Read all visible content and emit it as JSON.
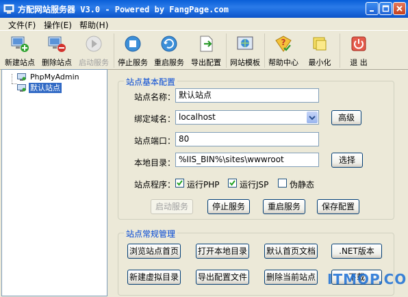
{
  "window": {
    "title": "方配网站服务器 V3.0 - Powered by FangPage.com"
  },
  "menu": [
    {
      "label": "文件(F)"
    },
    {
      "label": "操作(E)"
    },
    {
      "label": "帮助(H)"
    }
  ],
  "toolbar": [
    {
      "label": "新建站点",
      "icon": "new-site-icon",
      "enabled": true
    },
    {
      "label": "删除站点",
      "icon": "delete-site-icon",
      "enabled": true
    },
    {
      "label": "启动服务",
      "icon": "play-icon",
      "enabled": false
    },
    {
      "label": "停止服务",
      "icon": "stop-icon",
      "enabled": true
    },
    {
      "label": "重启服务",
      "icon": "restart-icon",
      "enabled": true
    },
    {
      "label": "导出配置",
      "icon": "export-icon",
      "enabled": true
    },
    {
      "label": "网站模板",
      "icon": "template-icon",
      "enabled": true
    },
    {
      "label": "帮助中心",
      "icon": "help-icon",
      "enabled": true
    },
    {
      "label": "最小化",
      "icon": "minimize-icon",
      "enabled": true
    },
    {
      "label": "退 出",
      "icon": "exit-icon",
      "enabled": true
    }
  ],
  "tree": [
    {
      "label": "PhpMyAdmin",
      "selected": false
    },
    {
      "label": "默认站点",
      "selected": true
    }
  ],
  "basic_config": {
    "title": "站点基本配置",
    "site_name_label": "站点名称：",
    "site_name_value": "默认站点",
    "domain_label": "绑定域名：",
    "domain_value": "localhost",
    "advanced_button": "高级",
    "port_label": "站点端口：",
    "port_value": "80",
    "dir_label": "本地目录：",
    "dir_value": "%IIS_BIN%\\sites\\wwwroot",
    "browse_button": "选择",
    "program_label": "站点程序：",
    "run_php": {
      "label": "运行PHP",
      "checked": true
    },
    "run_jsp": {
      "label": "运行JSP",
      "checked": true
    },
    "pseudo_static": {
      "label": "伪静态",
      "checked": false
    },
    "start_button": "启动服务",
    "stop_button": "停止服务",
    "restart_button": "重启服务",
    "save_button": "保存配置"
  },
  "common_mgmt": {
    "title": "站点常规管理",
    "buttons": [
      {
        "label": "浏览站点首页"
      },
      {
        "label": "打开本地目录"
      },
      {
        "label": "默认首页文档"
      },
      {
        "label": ".NET版本"
      },
      {
        "label": "新建虚拟目录"
      },
      {
        "label": "导出配置文件"
      },
      {
        "label": "删除当前站点"
      },
      {
        "label": "下载"
      }
    ]
  },
  "watermark": "ITMOP.COM",
  "colors": {
    "titlebar": "#0a5fd8",
    "group_title": "#0046d5",
    "selection": "#316ac5"
  }
}
